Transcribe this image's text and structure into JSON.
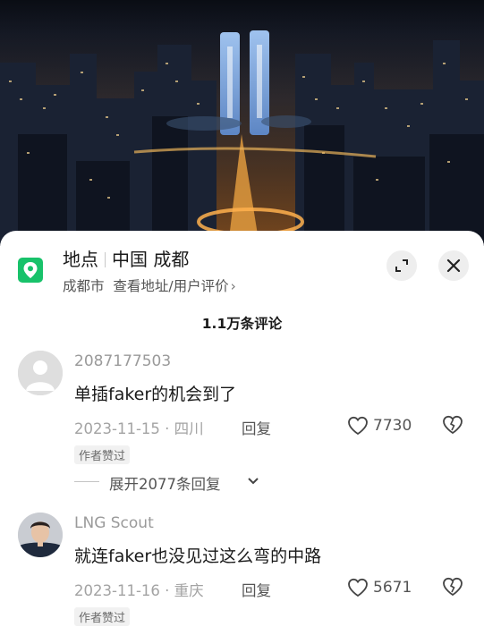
{
  "location": {
    "label": "地点",
    "place": "中国 成都",
    "city": "成都市",
    "link": "查看地址/用户评价",
    "chevron": "›",
    "icon": "map-pin-icon",
    "pin_color": "#18c26a"
  },
  "comments_count": "1.1万条评论",
  "comments": [
    {
      "user": "2087177503",
      "text": "单插faker的机会到了",
      "date": "2023-11-15 · 四川",
      "reply": "回复",
      "likes": "7730",
      "badge": "作者赞过",
      "expand": "展开2077条回复"
    },
    {
      "user": "LNG Scout",
      "text": "就连faker也没见过这么弯的中路",
      "date": "2023-11-16 · 重庆",
      "reply": "回复",
      "likes": "5671",
      "badge": "作者赞过"
    }
  ]
}
